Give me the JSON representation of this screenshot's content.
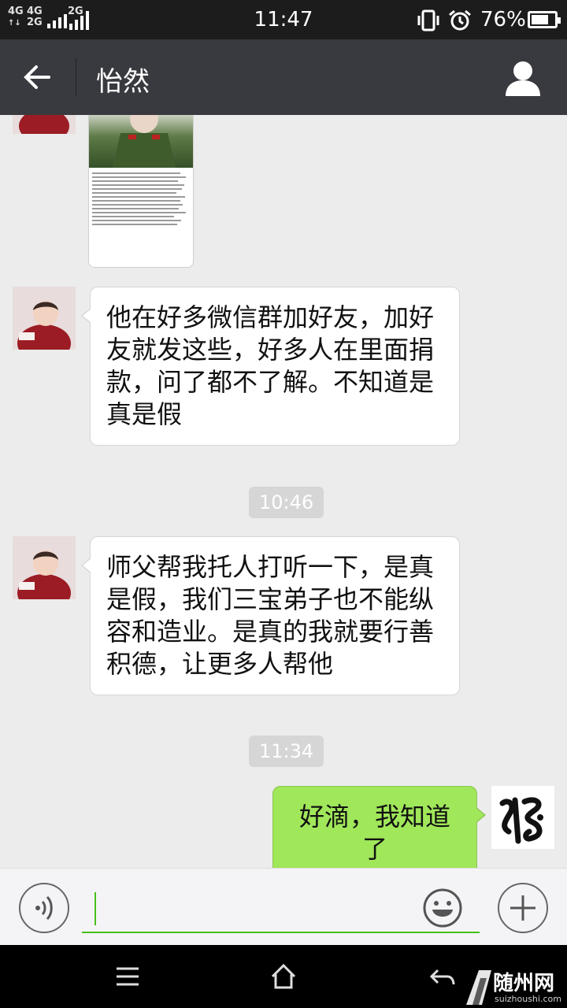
{
  "status_bar": {
    "signal_1": "4G",
    "signal_1_sub": "2G",
    "signal_2": "4G",
    "signal_3": "2G",
    "time": "11:47",
    "battery_percent": "76%",
    "battery_level": 0.76,
    "icons": [
      "vibrate-icon",
      "alarm-icon"
    ]
  },
  "header": {
    "title": "怡然",
    "back_icon": "back-arrow-icon",
    "profile_icon": "person-icon"
  },
  "messages": [
    {
      "type": "image",
      "direction": "in",
      "sender_avatar": "child-avatar"
    },
    {
      "type": "text",
      "direction": "in",
      "text": "他在好多微信群加好友，加好友就发这些，好多人在里面捐款，问了都不了解。不知道是真是假"
    },
    {
      "type": "time",
      "text": "10:46"
    },
    {
      "type": "text",
      "direction": "in",
      "text": "师父帮我托人打听一下，是真是假，我们三宝弟子也不能纵容和造业。是真的我就要行善积德，让更多人帮他"
    },
    {
      "type": "time",
      "text": "11:34"
    },
    {
      "type": "text",
      "direction": "out",
      "text": "好滴，我知道了"
    }
  ],
  "input_bar": {
    "voice_icon": "voice-icon",
    "emoji_icon": "emoji-icon",
    "plus_icon": "plus-icon",
    "value": ""
  },
  "nav_bar": {
    "icons": [
      "menu-icon",
      "home-icon",
      "back-icon"
    ]
  },
  "watermark": {
    "text": "随州网",
    "sub": "suizhoushi.com"
  },
  "colors": {
    "title_bar": "#393a3f",
    "out_bubble": "#a0e75a",
    "accent": "#45c01a",
    "chat_bg": "#ececec"
  }
}
